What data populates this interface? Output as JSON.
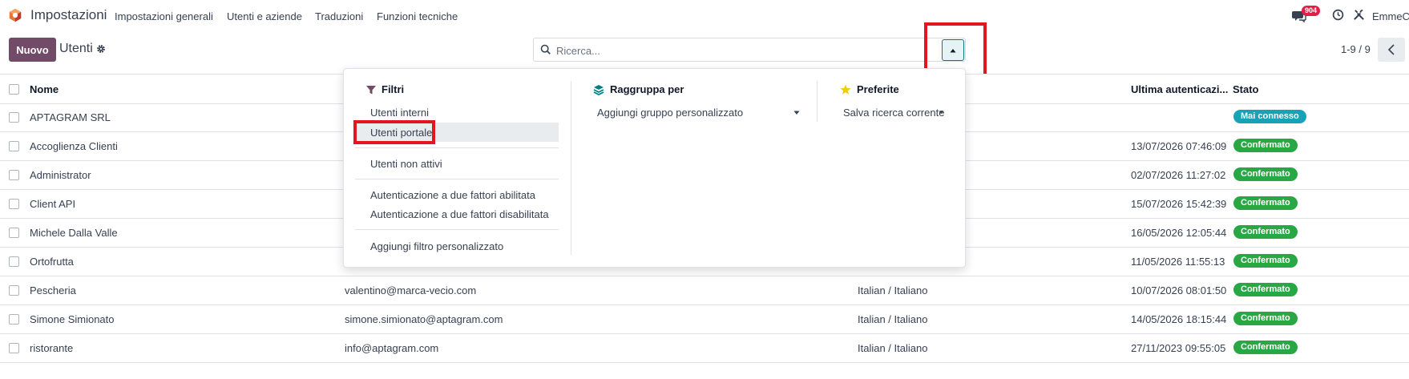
{
  "navbar": {
    "app_name": "Impostazioni",
    "menu": [
      "Impostazioni generali",
      "Utenti e aziende",
      "Traduzioni",
      "Funzioni tecniche"
    ],
    "chat_count": "904",
    "user_name": "EmmeCi"
  },
  "control": {
    "new_button": "Nuovo",
    "breadcrumb": "Utenti",
    "search_placeholder": "Ricerca...",
    "pager": "1-9 / 9"
  },
  "list": {
    "headers": {
      "name": "Nome",
      "last_auth": "Ultima autenticazi...",
      "status": "Stato"
    },
    "rows": [
      {
        "name": "APTAGRAM SRL",
        "email": "",
        "language": "",
        "last_auth": "",
        "status": "Mai connesso"
      },
      {
        "name": "Accoglienza Clienti",
        "email": "",
        "language": "",
        "last_auth": "13/07/2026 07:46:09",
        "status": "Confermato"
      },
      {
        "name": "Administrator",
        "email": "",
        "language": "",
        "last_auth": "02/07/2026 11:27:02",
        "status": "Confermato"
      },
      {
        "name": "Client API",
        "email": "",
        "language": "",
        "last_auth": "15/07/2026 15:42:39",
        "status": "Confermato"
      },
      {
        "name": "Michele Dalla Valle",
        "email": "",
        "language": "",
        "last_auth": "16/05/2026 12:05:44",
        "status": "Confermato"
      },
      {
        "name": "Ortofrutta",
        "email": "",
        "language": "",
        "last_auth": "11/05/2026 11:55:13",
        "status": "Confermato"
      },
      {
        "name": "Pescheria",
        "email": "valentino@marca-vecio.com",
        "language": "Italian / Italiano",
        "last_auth": "10/07/2026 08:01:50",
        "status": "Confermato"
      },
      {
        "name": "Simone Simionato",
        "email": "simone.simionato@aptagram.com",
        "language": "Italian / Italiano",
        "last_auth": "14/05/2026 18:15:44",
        "status": "Confermato"
      },
      {
        "name": "ristorante",
        "email": "info@aptagram.com",
        "language": "Italian / Italiano",
        "last_auth": "27/11/2023 09:55:05",
        "status": "Confermato"
      }
    ]
  },
  "dropdown": {
    "filters": {
      "title": "Filtri",
      "items": [
        "Utenti interni",
        "Utenti portale",
        "Utenti non attivi",
        "Autenticazione a due fattori abilitata",
        "Autenticazione a due fattori disabilitata",
        "Aggiungi filtro personalizzato"
      ]
    },
    "groupby": {
      "title": "Raggruppa per",
      "custom_group": "Aggiungi gruppo personalizzato"
    },
    "favorites": {
      "title": "Preferite",
      "save_search": "Salva ricerca corrente"
    }
  },
  "colors": {
    "brand": "#714B67",
    "accent": "#017e84",
    "confirmed": "#28a745",
    "never_connected": "#17a2b8",
    "highlight": "#e3161f",
    "chat_badge": "#e11d48"
  },
  "icons": [
    "app-logo-icon",
    "chat-icon",
    "clock-icon",
    "tools-icon",
    "gear-icon",
    "search-icon",
    "caret-up-icon",
    "chevron-left-icon",
    "filter-icon",
    "layers-icon",
    "star-icon",
    "caret-down-icon"
  ]
}
